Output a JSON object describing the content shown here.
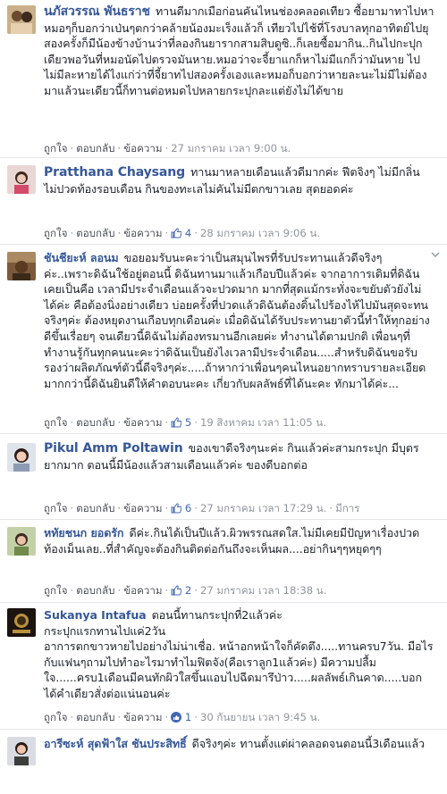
{
  "actions": {
    "like": "ถูกใจ",
    "reply": "ตอบกลับ",
    "message": "ข้อความ",
    "dot": "·"
  },
  "comments": [
    {
      "name": "นภัสวรรณ พันธราช",
      "text": "ทานดีมากเมือก่อนคันไหนช่องคลอดเทียว ซื้อยามาทาไปหาหมอๆก็บอกว่าเป่นๆตกว่าคล้ายน้องมะเร็งแล้วก็ เทียวไปไช้ที่โรงบาลทุกอาทิตย์ไปยุสองครั้งก็มีน้องข้างบ้านว่าที่ลองกินยารากสามสิบดูซิ..ก็เลยซื้อมากิน..กินไปกะปุกเดียวพอวันที่หมอนัดไปตรวจมันหาย.หมอว่าจะจี้ยาแกก็หาไม่มีแกก็ว่ามันหาย ไปไม่มีละหายได้ไงแก่ว่าที่จี้ยาทไปสองครั้งเองและหมอก็บอกว่าหายละนะไม่มีไม่ต้องมาแล้วนะเดียวนี้ก็ทานต่อหมดไปหลายกระปุกละแต่ยังไม่ได้ขาย",
      "likes": "",
      "time": "27 มกราคม เวลา 9:00 น."
    },
    {
      "name": "Pratthana Chaysang",
      "text": "ทานมาหลายเดือนแล้วดีมากค่ะ ฟีตจิงๆ ไม่มีกลิ่น ไม่ปวดท้องรอบเดือน กินของทะเลไม่คันไม่มีตกขาวเลย สุดยอดค่ะ",
      "likes": "4",
      "time": "28 มกราคม เวลา 9:06 น."
    },
    {
      "name": "ชันชียะห์ ลอนม",
      "text": "ขอยอมรับนะคะว่าเป็นสมุนไพรที่รับประทานแล้วดีจริงๆค่ะ..เพราะดิฉันใช้อยู่ตอนนี้ ดิฉันทานมาแล้วเกือบปีแล้วค่ะ จากอาการเดิมที่ดิฉันเคยเป็นคือ เวลามีประจำเดือนแล้วจะปวดมาก มากที่สุดแม้กระทั่งจะขยับตัวยังไม่ได้ค่ะ คือต้องนิ่งอย่างเดียว บ่อยครั้งที่ปวดแล้วดิฉันต้องดิ้นไปร้องไห้ไปมันสุดจะทนจริงๆค่ะ ต้องหยุดงานเกือบทุกเดือนค่ะ เมื่อดิฉันได้รับประทานยาตัวนี้ทำให้ทุกอย่างดีขึ้นเรื่อยๆ จนเดียวนี้ดิฉันไม่ต้องทรมานอีกเลยค่ะ ทำงานได้ตามปกติ เพื่อนๆที่ทำงานรู้กันทุกคนนะคะว่าดิฉันเป็นยังไงเวลามีประจำเดือน.....สำหรับดิฉันขอรับรองว่าผลิตภัณฑ์ตัวนี้ดีจริงๆค่ะ.....ถ้าหากว่าเพื่อนๆคนไหนอยากทราบรายละเอียดมากกว่านี้ดิฉันยินดีให้คำตอบนะคะ เกี่ยวกับผลลัพธ์ที่ได้นะคะ ทักมาได้ค่ะ...",
      "likes": "5",
      "time": "19 สิงหาคม เวลา 11:05 น."
    },
    {
      "name": "Pikul Amm Poltawin",
      "text": "ของเขาดีจริงๆนะค่ะ กินแล้วค่ะสามกระปุก มีบุตรยากมาก ตอนนี้มีน้องแล้วสามเดือนแล้วค่ะ ของดีบอกต่อ",
      "likes": "6",
      "time": "27 มกราคม เวลา 17:29 น.",
      "extra": "มีการ"
    },
    {
      "name": "หทัยชนก ยอดรัก",
      "text": "ดีค่ะ.กินได้เป็นปีแล้ว.ผิวพรรณสดใส.ไม่มีเคยมีปัญหาเรื่องปวดท้องเม็นเลย..ที่สำคัญจะต้องกินติดต่อกันถึงจะเห็นผล....อย่ากินๆๆหยุดๆๆ",
      "likes": "2",
      "time": "27 มกราคม เวลา 18:38 น."
    },
    {
      "name": "Sukanya Intafua",
      "text": "ตอนนี้ทานกระปุกที่2แล้วค่ะ\nกระปุกแรกทานไปแค่2วัน\nอาการตกขาวหายไปอย่างไม่น่าเชื่อ. หน้าอกหน้าใจก็คัดตึง.....ทานครบ7วัน. มือไรกับแฟนๆถามไปทำอะไรมาทำไมฟิตจัง(คือเราลูก1แล้วค่ะ) มีความปลื้มใจ......ครบ1เดือนมีคนทักผิวใสขึ้นแอบไปฉีดมารึป่าว.....ผลลัพธ์เกินคาด.....บอกได้คำเดียวสั่งต่อแน่นอนค่ะ",
      "likes": "1",
      "time": "30 กันยายน เวลา 9:45 น."
    },
    {
      "name": "อารีซะห์ สุดฟ้าใส ชันประสิทธิ์",
      "text": "ดีจริงๆค่ะ ทานตั้งแต่ผ่าคลอดจนตอนนี้3เดือนแล้ว",
      "likes": "",
      "time": ""
    }
  ],
  "colors": {
    "link": "#365899",
    "meta": "#90949c",
    "like": "#4267b2"
  },
  "icons": {
    "like": "thumbs-up-icon",
    "more": "chevron-down-icon"
  }
}
